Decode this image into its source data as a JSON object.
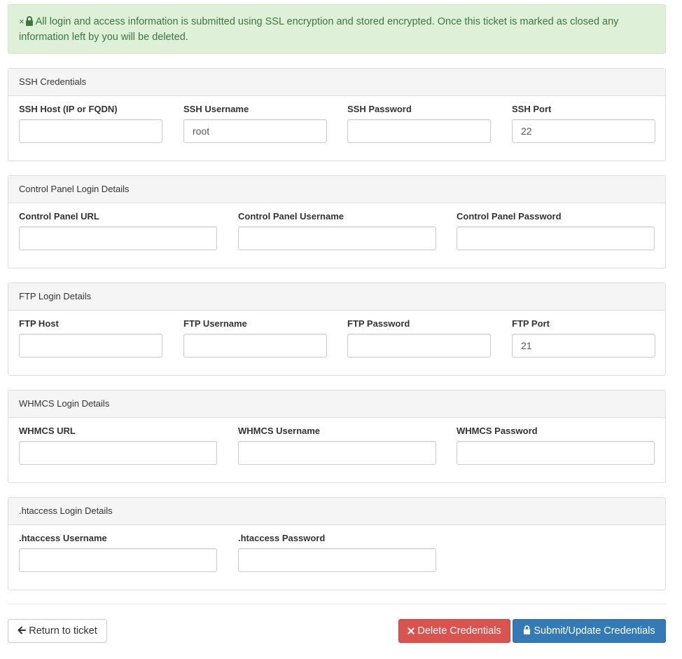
{
  "alert": {
    "close_symbol": "×",
    "icon": "lock-icon",
    "text": "All login and access information is submitted using SSL encryption and stored encrypted. Once this ticket is marked as closed any information left by you will be deleted.",
    "color": "#3c763d",
    "background": "#dff0d8"
  },
  "panels": {
    "ssh": {
      "title": "SSH Credentials",
      "fields": [
        {
          "label": "SSH Host (IP or FQDN)",
          "value": ""
        },
        {
          "label": "SSH Username",
          "value": "root"
        },
        {
          "label": "SSH Password",
          "value": ""
        },
        {
          "label": "SSH Port",
          "value": "22"
        }
      ]
    },
    "cpanel": {
      "title": "Control Panel Login Details",
      "fields": [
        {
          "label": "Control Panel URL",
          "value": ""
        },
        {
          "label": "Control Panel Username",
          "value": ""
        },
        {
          "label": "Control Panel Password",
          "value": ""
        }
      ]
    },
    "ftp": {
      "title": "FTP Login Details",
      "fields": [
        {
          "label": "FTP Host",
          "value": ""
        },
        {
          "label": "FTP Username",
          "value": ""
        },
        {
          "label": "FTP Password",
          "value": ""
        },
        {
          "label": "FTP Port",
          "value": "21"
        }
      ]
    },
    "whmcs": {
      "title": "WHMCS Login Details",
      "fields": [
        {
          "label": "WHMCS URL",
          "value": ""
        },
        {
          "label": "WHMCS Username",
          "value": ""
        },
        {
          "label": "WHMCS Password",
          "value": ""
        }
      ]
    },
    "htaccess": {
      "title": ".htaccess Login Details",
      "fields": [
        {
          "label": ".htaccess Username",
          "value": ""
        },
        {
          "label": ".htaccess Password",
          "value": ""
        }
      ]
    }
  },
  "actions": {
    "return_label": "Return to ticket",
    "return_icon": "arrow-left-icon",
    "delete_label": "Delete Credentials",
    "delete_icon": "times-icon",
    "submit_label": "Submit/Update Credentials",
    "submit_icon": "lock-icon"
  },
  "colors": {
    "danger": "#d9534f",
    "primary": "#337ab7",
    "panel_heading": "#f5f5f5"
  }
}
